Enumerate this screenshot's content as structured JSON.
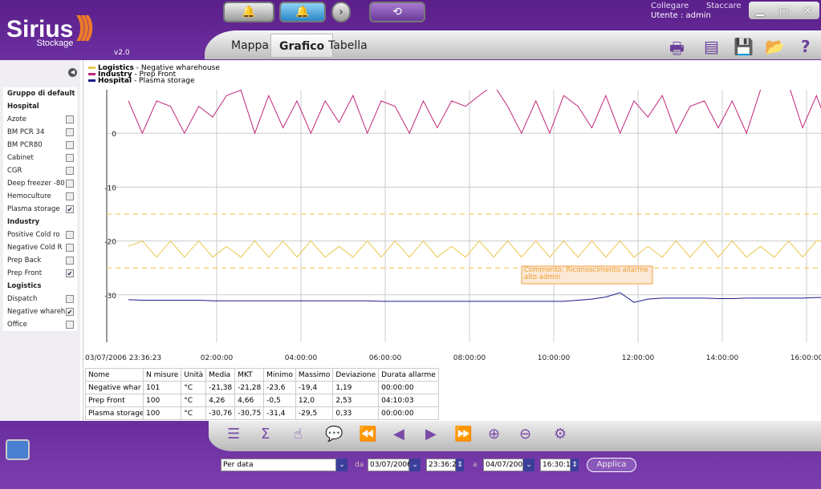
{
  "app": {
    "name": "Sirius",
    "subtitle": "Stockage",
    "version": "v2.0"
  },
  "header": {
    "connect": "Collegare",
    "disconnect": "Staccare",
    "user": "Utente : admin",
    "window_controls": [
      "minimize-icon",
      "maximize-icon",
      "close-icon"
    ],
    "tabs": [
      {
        "label": "Mappa"
      },
      {
        "label": "Grafico",
        "active": true
      },
      {
        "label": "Tabella"
      }
    ],
    "toolbar_icons": [
      "print-icon",
      "document-icon",
      "save-icon",
      "open-folder-icon",
      "help-icon"
    ]
  },
  "sidebar": {
    "group": "Gruppo di default",
    "sections": [
      {
        "name": "Hospital",
        "items": [
          {
            "label": "Azote",
            "checked": false
          },
          {
            "label": "BM PCR 34",
            "checked": false
          },
          {
            "label": "BM PCR80",
            "checked": false
          },
          {
            "label": "Cabinet",
            "checked": false
          },
          {
            "label": "CGR",
            "checked": false
          },
          {
            "label": "Deep freezer -80",
            "checked": false
          },
          {
            "label": "Hemoculture",
            "checked": false
          },
          {
            "label": "Plasma storage",
            "checked": true
          }
        ]
      },
      {
        "name": "Industry",
        "items": [
          {
            "label": "Positive  Cold ro",
            "checked": false
          },
          {
            "label": "Negative  Cold R",
            "checked": false
          },
          {
            "label": "Prep Back",
            "checked": false
          },
          {
            "label": "Prep Front",
            "checked": true
          }
        ]
      },
      {
        "name": "Logistics",
        "items": [
          {
            "label": "Dispatch",
            "checked": false
          },
          {
            "label": "Negative  whareh",
            "checked": true
          },
          {
            "label": "Office",
            "checked": false
          }
        ]
      }
    ]
  },
  "legend": [
    {
      "group": "Logistics",
      "name": "- Negative  wharehouse",
      "color": "#e8c84a"
    },
    {
      "group": "Industry",
      "name": "- Prep Front",
      "color": "#c0267a"
    },
    {
      "group": "Hospital",
      "name": "- Plasma storage",
      "color": "#1a1a8c"
    }
  ],
  "chart_data": {
    "type": "line",
    "x_start_label": "03/07/2006 23:36:23",
    "x_ticks": [
      "02:00:00",
      "04:00:00",
      "06:00:00",
      "08:00:00",
      "10:00:00",
      "12:00:00",
      "14:00:00",
      "16:00:00"
    ],
    "y_ticks": [
      10,
      0,
      -10,
      -20,
      -30
    ],
    "ylim": [
      -33,
      14
    ],
    "grid": true,
    "thresholds": [
      -15,
      -25
    ],
    "annotation": "Commento: Riconoscimento allarme alto admin",
    "x_hours": [
      0,
      0.33,
      0.67,
      1,
      1.33,
      1.67,
      2,
      2.33,
      2.67,
      3,
      3.33,
      3.67,
      4,
      4.33,
      4.67,
      5,
      5.33,
      5.67,
      6,
      6.33,
      6.67,
      7,
      7.33,
      7.67,
      8,
      8.33,
      8.67,
      9,
      9.33,
      9.67,
      10,
      10.33,
      10.67,
      11,
      11.33,
      11.67,
      12,
      12.33,
      12.67,
      13,
      13.33,
      13.67,
      14,
      14.33,
      14.67,
      15,
      15.33,
      15.67,
      16,
      16.33,
      16.67
    ],
    "series": [
      {
        "name": "Prep Front",
        "color": "#c0267a",
        "values": [
          6,
          0,
          6,
          5,
          0,
          5,
          3,
          7,
          8,
          0,
          7,
          1,
          6,
          0,
          6,
          2,
          7,
          0,
          6,
          5,
          0,
          6,
          1,
          6,
          5,
          7,
          9,
          5,
          0,
          6,
          0,
          7,
          5,
          1,
          7,
          0,
          6,
          3,
          7,
          0,
          5,
          6,
          1,
          6,
          0,
          8,
          12,
          9,
          1,
          7,
          0
        ]
      },
      {
        "name": "Negative  wharehouse",
        "color": "#e8c84a",
        "values": [
          -21,
          -20,
          -23,
          -20,
          -23,
          -20,
          -23,
          -21,
          -23,
          -20,
          -23,
          -20,
          -23,
          -20,
          -23,
          -21,
          -23,
          -20,
          -23,
          -20,
          -23,
          -20,
          -23,
          -21,
          -23,
          -20,
          -23,
          -20,
          -23,
          -20,
          -23,
          -20,
          -23,
          -20,
          -23,
          -20,
          -23,
          -21,
          -23,
          -20,
          -23,
          -20,
          -23,
          -20,
          -23,
          -21,
          -23,
          -20,
          -23,
          -20,
          -20
        ]
      },
      {
        "name": "Plasma storage",
        "color": "#1a1a8c",
        "values": [
          -30.9,
          -31,
          -31,
          -31,
          -31,
          -31,
          -31.1,
          -31.1,
          -31.1,
          -31.1,
          -31.1,
          -31.1,
          -31.1,
          -31.1,
          -31.1,
          -31.1,
          -31.1,
          -31.1,
          -31.2,
          -31.2,
          -31.2,
          -31.2,
          -31.2,
          -31.2,
          -31.2,
          -31.2,
          -31.2,
          -31.2,
          -31.2,
          -31.2,
          -31.2,
          -31.2,
          -31,
          -30.8,
          -30.4,
          -29.6,
          -31.4,
          -30.8,
          -30.6,
          -30.6,
          -30.6,
          -30.6,
          -30.7,
          -30.7,
          -30.6,
          -30.6,
          -30.6,
          -30.6,
          -30.6,
          -30.5,
          -30.5
        ]
      }
    ]
  },
  "table": {
    "headers": [
      "Nome",
      "N misure",
      "Unità",
      "Media",
      "MKT",
      "Minimo",
      "Massimo",
      "Deviazione",
      "Durata allarme"
    ],
    "rows": [
      [
        "Negative  whar",
        "101",
        "°C",
        "-21,38",
        "-21,28",
        "-23,6",
        "-19,4",
        "1,19",
        "00:00:00"
      ],
      [
        "Prep Front",
        "100",
        "°C",
        "4,26",
        "4,66",
        "-0,5",
        "12,0",
        "2,53",
        "04:10:03"
      ],
      [
        "Plasma storage",
        "100",
        "°C",
        "-30,76",
        "-30,75",
        "-31,4",
        "-29,5",
        "0,33",
        "00:00:00"
      ]
    ]
  },
  "filter": {
    "mode": "Per data",
    "from_label": "da",
    "from_date": "03/07/2006",
    "from_time": "23:36:23",
    "to_label": "a",
    "to_date": "04/07/2006",
    "to_time": "16:30:18",
    "apply": "Applica"
  }
}
